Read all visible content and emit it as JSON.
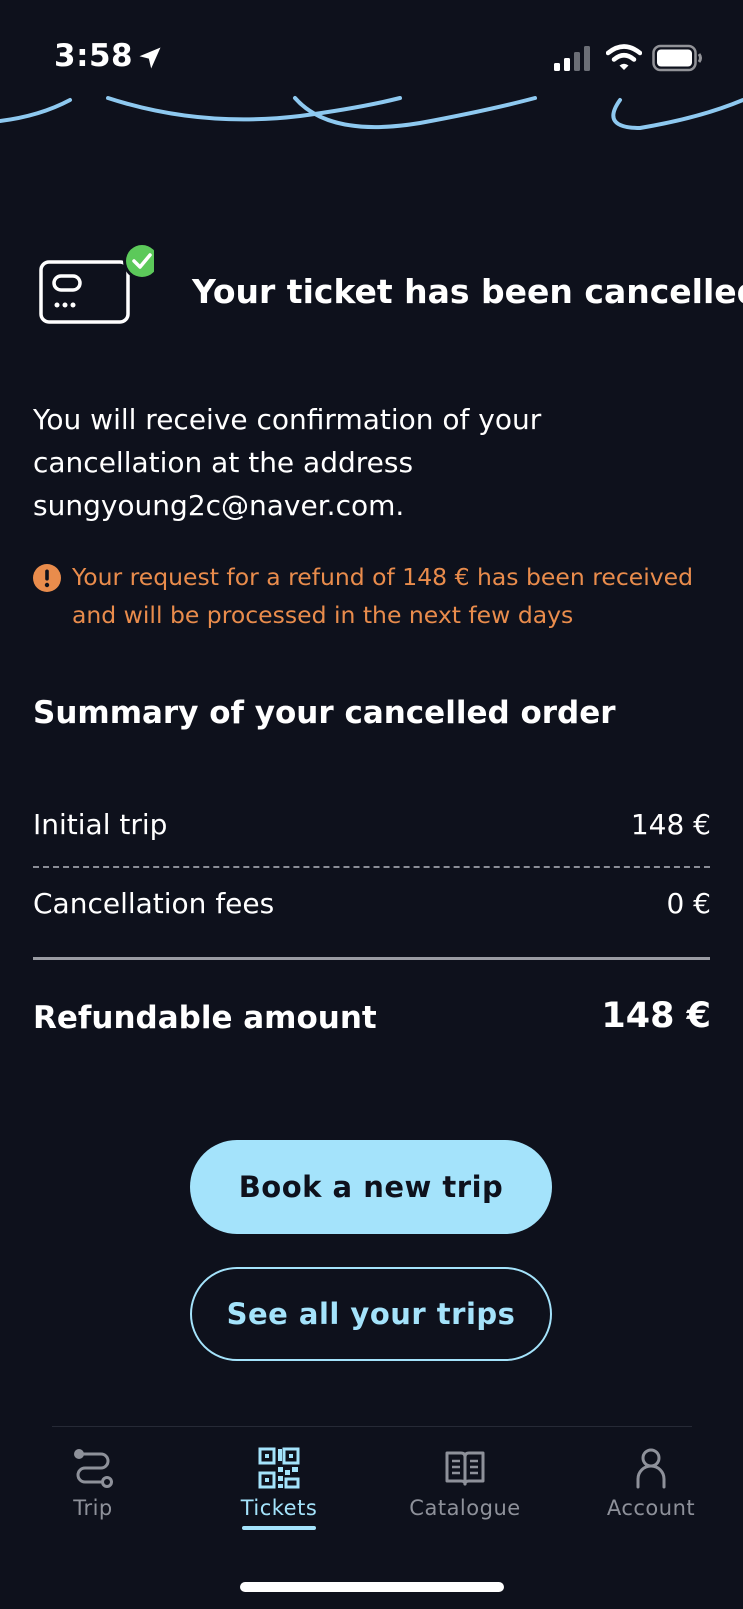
{
  "status_bar": {
    "time": "3:58",
    "icons": [
      "location-arrow-icon",
      "cellular-signal-icon",
      "wifi-icon",
      "battery-icon"
    ]
  },
  "confirmation": {
    "icon": "ticket-checked-icon",
    "title": "Your ticket has been cancelled.",
    "info_text": "You will receive confirmation of your cancellation at the address sungyoung2c@naver.com.",
    "warning_icon": "exclamation-circle-icon",
    "refund_notice": "Your request for a refund of 148 € has been received and will be processed in the next few days"
  },
  "summary": {
    "title": "Summary of your cancelled order",
    "rows": [
      {
        "label": "Initial trip",
        "value": "148 €"
      },
      {
        "label": "Cancellation fees",
        "value": "0 €"
      }
    ],
    "total": {
      "label": "Refundable amount",
      "value": "148 €"
    }
  },
  "actions": {
    "book_label": "Book a new trip",
    "see_trips_label": "See all your trips"
  },
  "bottom_nav": {
    "items": [
      {
        "label": "Trip",
        "icon": "route-icon"
      },
      {
        "label": "Tickets",
        "icon": "qr-code-icon",
        "active": true
      },
      {
        "label": "Catalogue",
        "icon": "book-icon"
      },
      {
        "label": "Account",
        "icon": "person-icon"
      }
    ]
  },
  "colors": {
    "background": "#0e111c",
    "accent": "#a4e3fb",
    "warning": "#e98c4c",
    "success": "#5cc95a"
  }
}
